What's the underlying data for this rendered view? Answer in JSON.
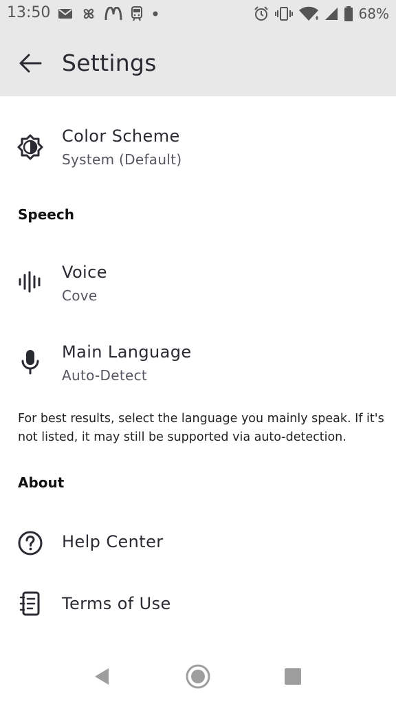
{
  "status_bar": {
    "time": "13:50",
    "battery_percent": "68%",
    "notification_icons": [
      "gmail-icon",
      "fan-icon",
      "mcdonalds-icon",
      "transit-icon",
      "more-dot-icon"
    ],
    "system_icons": [
      "alarm-icon",
      "vibrate-icon",
      "wifi-icon",
      "signal-icon",
      "battery-icon"
    ]
  },
  "app_bar": {
    "title": "Settings",
    "back_icon": "arrow-left-icon"
  },
  "general": {
    "color_scheme": {
      "label": "Color Scheme",
      "value": "System (Default)",
      "icon": "brightness-icon"
    }
  },
  "speech": {
    "header": "Speech",
    "voice": {
      "label": "Voice",
      "value": "Cove",
      "icon": "waveform-icon"
    },
    "main_language": {
      "label": "Main Language",
      "value": "Auto-Detect",
      "icon": "microphone-icon"
    },
    "hint": "For best results, select the language you mainly speak. If it's not listed, it may still be supported via auto-detection."
  },
  "about": {
    "header": "About",
    "help_center": {
      "label": "Help Center",
      "icon": "help-circle-icon"
    },
    "terms_of_use": {
      "label": "Terms of Use",
      "icon": "document-icon"
    }
  },
  "nav_bar": {
    "icons": [
      "back-triangle-icon",
      "home-circle-icon",
      "recents-square-icon"
    ],
    "color": "#9e9e9e"
  },
  "colors": {
    "app_bar_bg": "#e8e8e8",
    "text_primary": "#2a2a33",
    "text_secondary": "#555560"
  }
}
